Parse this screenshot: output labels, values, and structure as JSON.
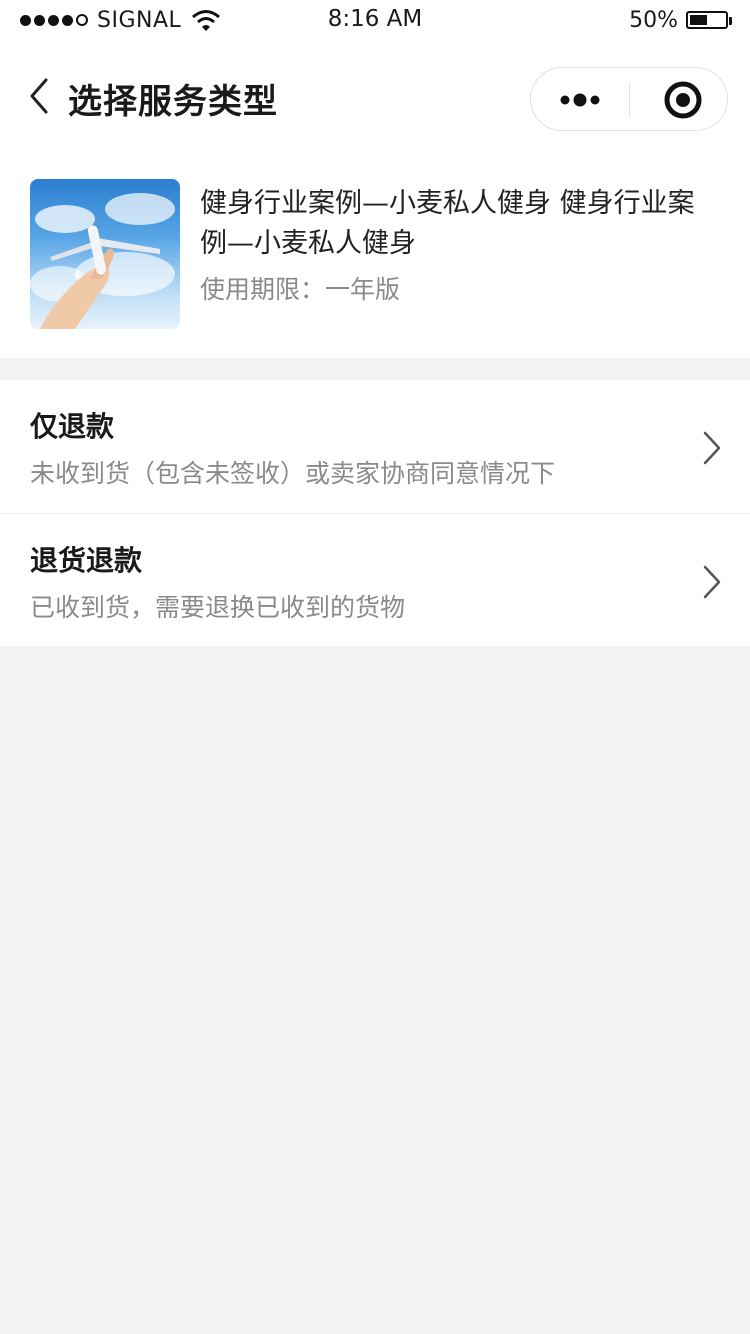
{
  "status_bar": {
    "carrier": "SIGNAL",
    "time": "8:16 AM",
    "battery_percent": "50%",
    "signal_bars_filled": 4,
    "signal_bars_total": 5,
    "battery_level": 0.5
  },
  "nav": {
    "title": "选择服务类型",
    "back_icon": "chevron-left-icon",
    "capsule_icons": [
      "more-dots-icon",
      "target-circle-icon"
    ]
  },
  "product": {
    "name": "健身行业案例—小麦私人健身 健身行业案例—小麦私人健身",
    "term": "使用期限：一年版"
  },
  "options": [
    {
      "title": "仅退款",
      "description": "未收到货（包含未签收）或卖家协商同意情况下"
    },
    {
      "title": "退货退款",
      "description": "已收到货，需要退换已收到的货物"
    }
  ],
  "colors": {
    "background": "#f2f2f2",
    "card": "#ffffff",
    "primary_text": "#1a1a1a",
    "secondary_text": "#8a8a8a"
  }
}
